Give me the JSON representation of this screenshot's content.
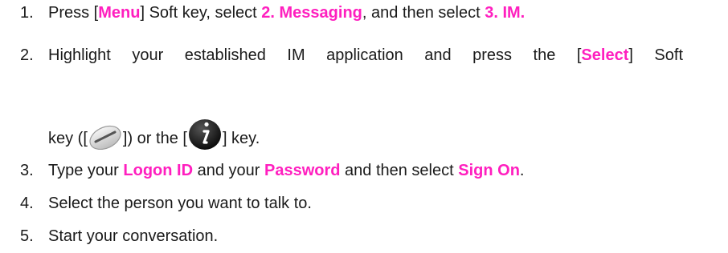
{
  "steps": [
    {
      "number": "1.",
      "parts": [
        "Press [",
        "Menu",
        "] Soft key, select ",
        "2. Messaging",
        ", and then select ",
        "3. IM."
      ]
    },
    {
      "number": "2.",
      "text_line1": "Highlight your established IM application and press the [",
      "highlight": "Select",
      "text_line1_end": "] Soft",
      "text_line2_a": "key ([",
      "text_line2_b": "]) or the [",
      "text_line2_c": "] key."
    },
    {
      "number": "3.",
      "parts": [
        "Type your ",
        "Logon ID",
        " and your ",
        "Password",
        " and then select ",
        "Sign On",
        "."
      ]
    },
    {
      "number": "4.",
      "text": "Select the person you want to talk to."
    },
    {
      "number": "5.",
      "text": "Start your conversation."
    }
  ],
  "icons": {
    "soft_key": "soft-key-icon",
    "info_key": "info-key-icon"
  },
  "colors": {
    "highlight": "#ff1fbf",
    "text": "#1a1a1a"
  }
}
